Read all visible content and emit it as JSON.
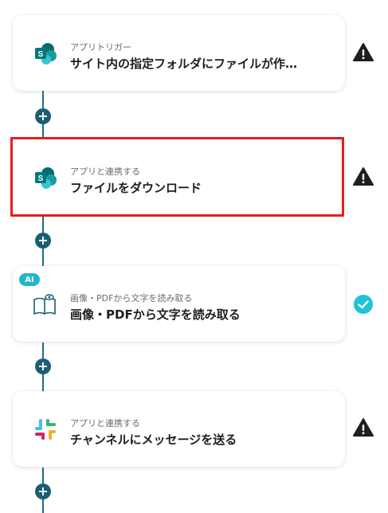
{
  "steps": [
    {
      "subtitle": "アプリトリガー",
      "title": "サイト内の指定フォルダにファイルが作…",
      "icon": "sharepoint-icon",
      "status": "warning-icon"
    },
    {
      "subtitle": "アプリと連携する",
      "title": "ファイルをダウンロード",
      "icon": "sharepoint-icon",
      "status": "warning-icon",
      "selected": true
    },
    {
      "subtitle": "画像・PDFから文字を読み取る",
      "title": "画像・PDFから文字を読み取る",
      "icon": "ocr-book-icon",
      "status": "check-icon",
      "badge": "AI"
    },
    {
      "subtitle": "アプリと連携する",
      "title": "チャンネルにメッセージを送る",
      "icon": "slack-icon",
      "status": "warning-icon"
    }
  ],
  "add_button_label": "+",
  "colors": {
    "connector": "#1f6f87",
    "plus": "#1a5e73",
    "selected_border": "#e21f1f",
    "check": "#1fc2d6",
    "warning": "#1e1e1e"
  }
}
